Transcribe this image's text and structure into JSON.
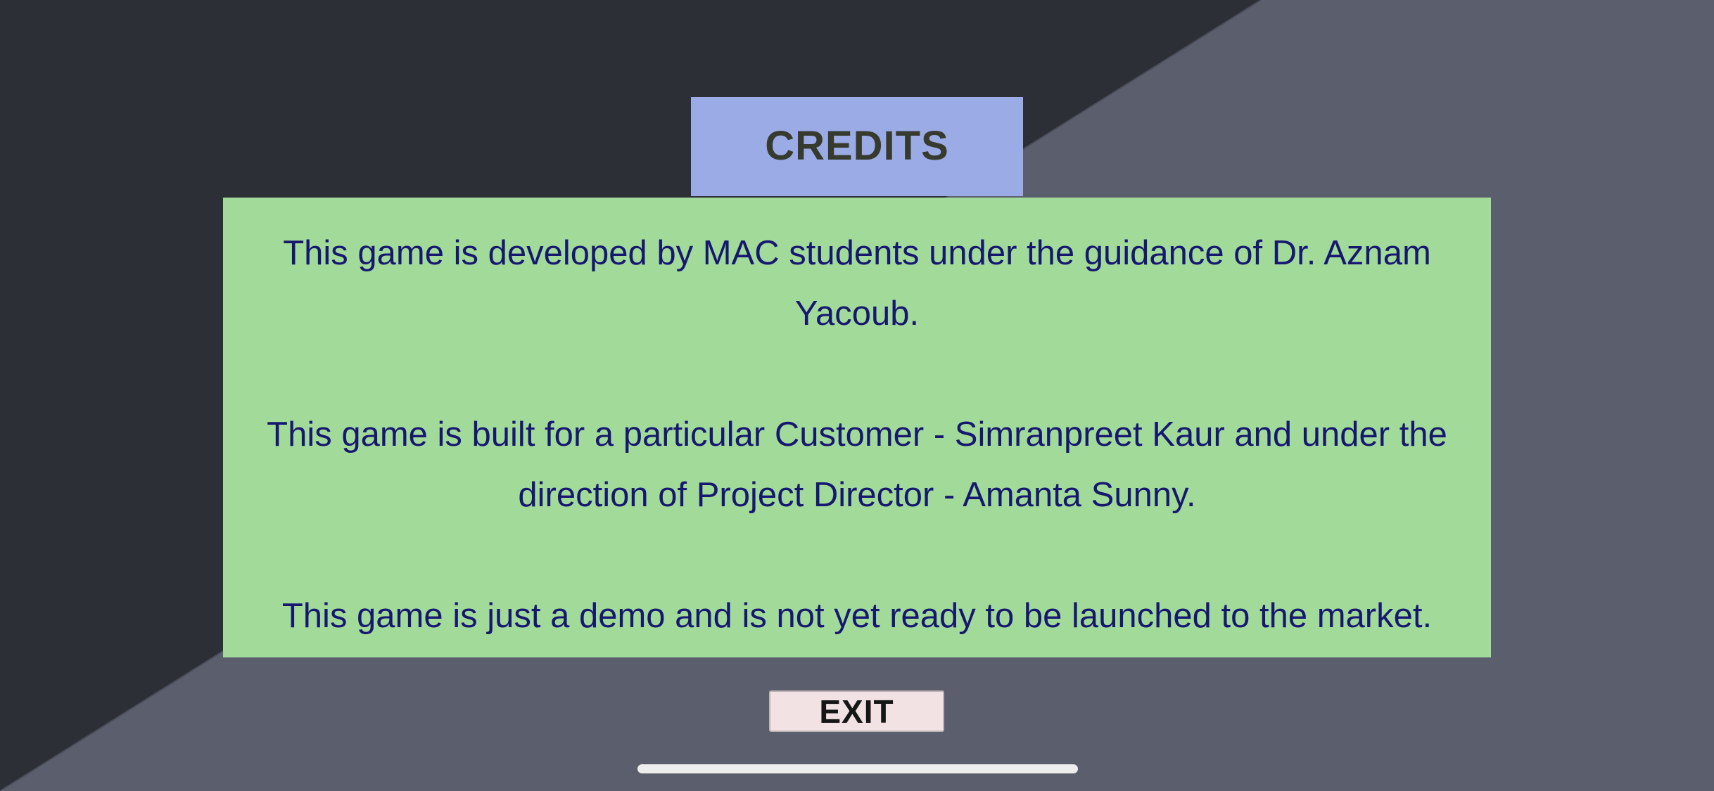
{
  "screen": {
    "title": "CREDITS",
    "paragraphs": [
      "This game is developed by MAC students under the guidance of Dr. Aznam Yacoub.",
      "This game is built for a particular Customer - Simranpreet Kaur and under the direction of Project Director - Amanta Sunny.",
      "This game is just a demo and is not yet ready to be launched to the market."
    ],
    "exit_label": "EXIT"
  },
  "colors": {
    "background_dark": "#2c2f35",
    "background_light": "#5b5f6d",
    "title_box": "#9aabe6",
    "panel": "#a2da9a",
    "body_text": "#161870",
    "title_text": "#373a2e",
    "exit_button": "#f2e2e4"
  }
}
